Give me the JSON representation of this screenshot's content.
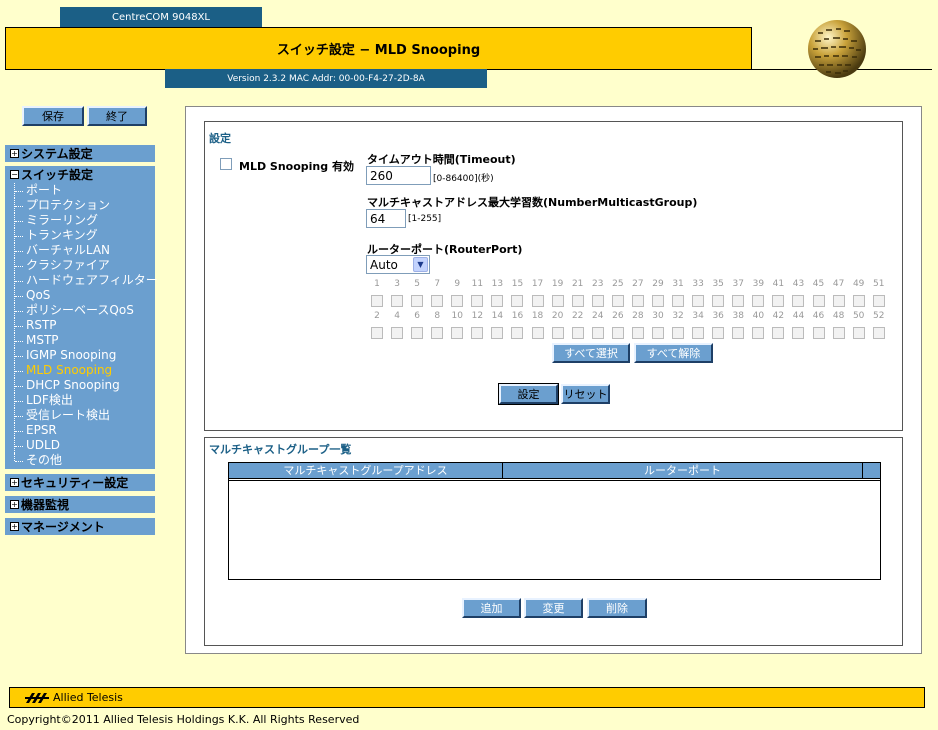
{
  "header": {
    "model": "CentreCOM 9048XL",
    "title": "スイッチ設定 − MLD Snooping",
    "version": "Version 2.3.2 MAC Addr: 00-00-F4-27-2D-8A"
  },
  "sidebar": {
    "save_label": "保存",
    "exit_label": "終了",
    "system": "システム設定",
    "switch": "スイッチ設定",
    "switch_items": [
      "ポート",
      "プロテクション",
      "ミラーリング",
      "トランキング",
      "バーチャルLAN",
      "クラシファイア",
      "ハードウェアフィルター",
      "QoS",
      "ポリシーベースQoS",
      "RSTP",
      "MSTP",
      "IGMP Snooping",
      "MLD Snooping",
      "DHCP Snooping",
      "LDF検出",
      "受信レート検出",
      "EPSR",
      "UDLD",
      "その他"
    ],
    "active_item": "MLD Snooping",
    "security": "セキュリティー設定",
    "monitor": "機器監視",
    "management": "マネージメント",
    "expand_symbol": "+",
    "collapse_symbol": "−"
  },
  "settings": {
    "group_title": "設定",
    "mld_enable_label": "MLD Snooping 有効",
    "timeout_label": "タイムアウト時間(Timeout)",
    "timeout_value": "260",
    "timeout_range": "[0-86400](秒)",
    "max_groups_label": "マルチキャストアドレス最大学習数(NumberMulticastGroup)",
    "max_groups_value": "64",
    "max_groups_range": "[1-255]",
    "router_port_label": "ルーターポート(RouterPort)",
    "router_port_value": "Auto",
    "odd_ports": [
      "1",
      "3",
      "5",
      "7",
      "9",
      "11",
      "13",
      "15",
      "17",
      "19",
      "21",
      "23",
      "25",
      "27",
      "29",
      "31",
      "33",
      "35",
      "37",
      "39",
      "41",
      "43",
      "45",
      "47",
      "49",
      "51"
    ],
    "even_ports": [
      "2",
      "4",
      "6",
      "8",
      "10",
      "12",
      "14",
      "16",
      "18",
      "20",
      "22",
      "24",
      "26",
      "28",
      "30",
      "32",
      "34",
      "36",
      "38",
      "40",
      "42",
      "44",
      "46",
      "48",
      "50",
      "52"
    ],
    "select_all_label": "すべて選択",
    "clear_all_label": "すべて解除",
    "set_label": "設定",
    "reset_label": "リセット"
  },
  "list": {
    "group_title": "マルチキャストグループ一覧",
    "col_address": "マルチキャストグループアドレス",
    "col_router_port": "ルーターポート",
    "add_label": "追加",
    "change_label": "変更",
    "delete_label": "削除"
  },
  "footer": {
    "brand": "Allied Telesis",
    "copyright": "Copyright©2011 Allied Telesis Holdings K.K. All Rights Reserved"
  },
  "colors": {
    "background": "#ffffcc",
    "accent": "#ffcc00",
    "nav": "#6b9fcf",
    "header_blue": "#1b5f86"
  }
}
